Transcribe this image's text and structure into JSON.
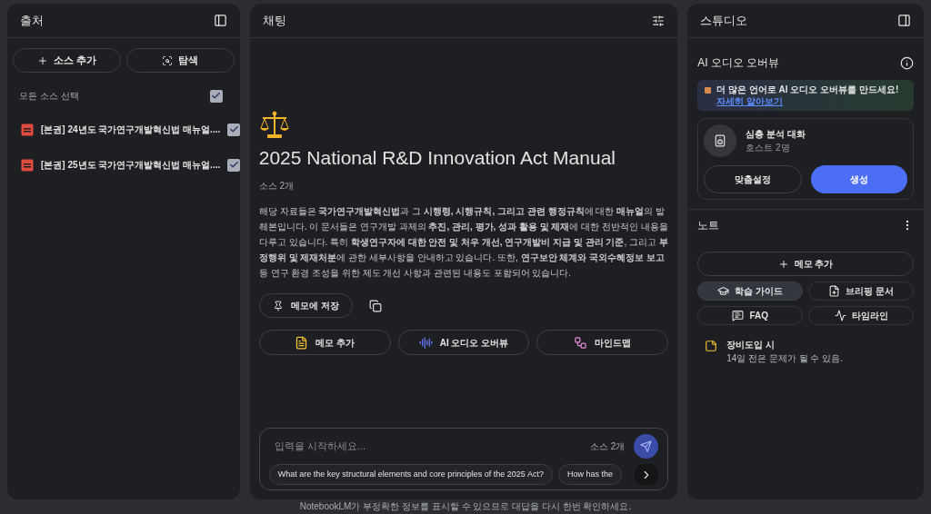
{
  "sources": {
    "title": "출처",
    "add_button": "소스 추가",
    "explore_button": "탐색",
    "select_all": {
      "label": "모든 소스 선택",
      "checked": true
    },
    "items": [
      {
        "title": "[본권] 24년도 국가연구개발혁신법 매뉴얼....",
        "checked": true
      },
      {
        "title": "[본권] 25년도 국가연구개발혁신법 매뉴얼....",
        "checked": true
      }
    ]
  },
  "chat": {
    "title": "채팅",
    "notebook_title": "2025 National R&D Innovation Act Manual",
    "source_count": "소스 2개",
    "summary": "해당 자료들은 **국가연구개발혁신법**과 그 **시행령, 시행규칙, 그리고 관련 행정규칙**에 대한 **매뉴얼**의 발췌본입니다. 이 문서들은 연구개발 과제의 **추진, 관리, 평가, 성과 활용 및 제재**에 대한 전반적인 내용을 다루고 있습니다. 특히 **학생연구자에 대한 안전 및 처우 개선, 연구개발비 지급 및 관리 기준**, 그리고 **부정행위 및 제재처분**에 관한 세부사항을 안내하고 있습니다. 또한, **연구보안 체계와 국외수혜정보 보고** 등 연구 환경 조성을 위한 제도 개선 사항과 관련된 내용도 포함되어 있습니다.",
    "save_note_button": "메모에 저장",
    "actions": [
      {
        "kind": "note",
        "label": "메모 추가"
      },
      {
        "kind": "audio",
        "label": "AI 오디오 오버뷰"
      },
      {
        "kind": "mindmap",
        "label": "마인드맵"
      }
    ],
    "input": {
      "placeholder": "입력을 시작하세요...",
      "source_count": "소스 2개"
    },
    "suggestions": [
      "What are the key structural elements and core principles of the 2025 Act?",
      "How has the"
    ]
  },
  "studio": {
    "title": "스튜디오",
    "audio_overview": {
      "title": "AI 오디오 오버뷰",
      "banner": "더 많은 언어로 AI 오디오 오버뷰를 만드세요!",
      "banner_link": "자세히 알아보기",
      "card_title": "심층 분석 대화",
      "card_subtitle": "호스트 2명",
      "customize_button": "맞춤설정",
      "generate_button": "생성"
    },
    "notes": {
      "title": "노트",
      "add_button": "메모 추가",
      "tools": [
        {
          "kind": "guide",
          "label": "학습 가이드",
          "selected": true
        },
        {
          "kind": "briefing",
          "label": "브리핑 문서",
          "selected": false
        },
        {
          "kind": "faq",
          "label": "FAQ",
          "selected": false
        },
        {
          "kind": "timeline",
          "label": "타임라인",
          "selected": false
        }
      ],
      "items": [
        {
          "title": "장비도입 시",
          "subtitle": "14일 전은 문제가 될 수 있음."
        }
      ]
    }
  },
  "footer": "NotebookLM가 부정확한 정보를 표시할 수 있으므로 대답을 다시 한번 확인하세요."
}
